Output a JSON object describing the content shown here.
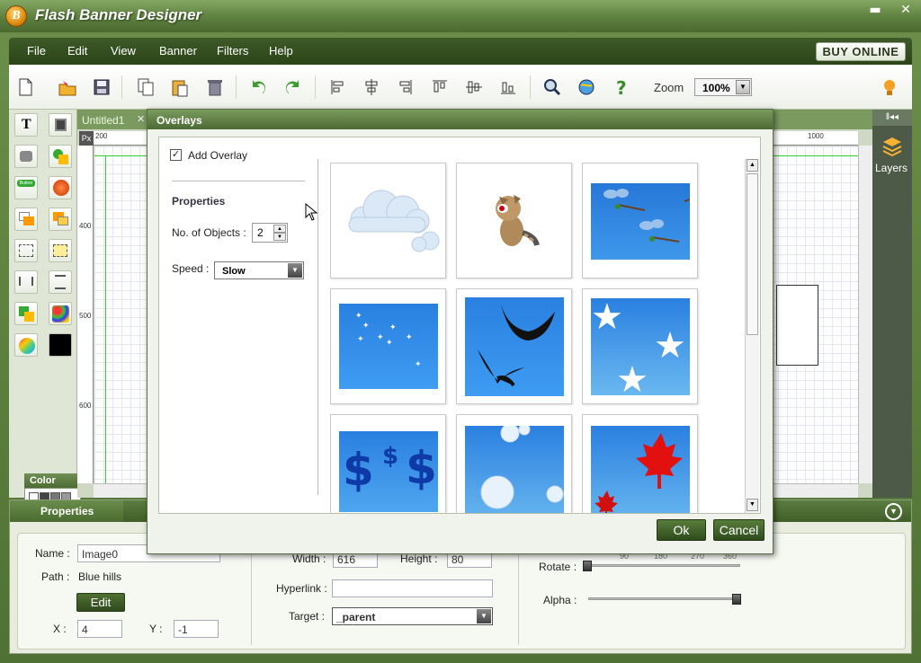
{
  "app": {
    "title": "Flash Banner Designer",
    "logo_letter": "B"
  },
  "menu": {
    "items": [
      "File",
      "Edit",
      "View",
      "Banner",
      "Filters",
      "Help"
    ],
    "buy_label": "BUY ONLINE"
  },
  "toolbar": {
    "zoom_label": "Zoom",
    "zoom_value": "100%"
  },
  "left_tools": {
    "color_title": "Color",
    "button_label": "Button"
  },
  "canvas": {
    "tab_label": "Untitled1",
    "tab_close": "✕",
    "px_label": "Px",
    "ruler_top": [
      "200",
      "1000"
    ],
    "ruler_left": [
      "400",
      "500",
      "600"
    ]
  },
  "right_panel": {
    "layers_label": "Layers"
  },
  "dialog": {
    "title": "Overlays",
    "add_overlay_label": "Add Overlay",
    "properties_heading": "Properties",
    "objects_label": "No. of Objects :",
    "objects_value": "2",
    "speed_label": "Speed :",
    "speed_value": "Slow",
    "ok_label": "Ok",
    "cancel_label": "Cancel",
    "thumbnails": [
      "clouds",
      "raccoon",
      "dragonflies",
      "sparkles",
      "birds",
      "stars",
      "dollars",
      "bubbles",
      "maple-leaves"
    ]
  },
  "properties": {
    "tab_label": "Properties",
    "name_label": "Name :",
    "name_value": "Image0",
    "path_label": "Path :",
    "path_value": "Blue hills",
    "edit_label": "Edit",
    "x_label": "X :",
    "x_value": "4",
    "y_label": "Y :",
    "y_value": "-1",
    "width_label": "Width :",
    "width_value": "616",
    "height_label": "Height :",
    "height_value": "80",
    "hyperlink_label": "Hyperlink :",
    "hyperlink_value": "",
    "target_label": "Target :",
    "target_value": "_parent",
    "rotate_label": "Rotate :",
    "rotate_ticks": [
      "90",
      "180",
      "270",
      "360"
    ],
    "alpha_label": "Alpha :",
    "rotate_value": 0,
    "alpha_value": 1.0
  }
}
